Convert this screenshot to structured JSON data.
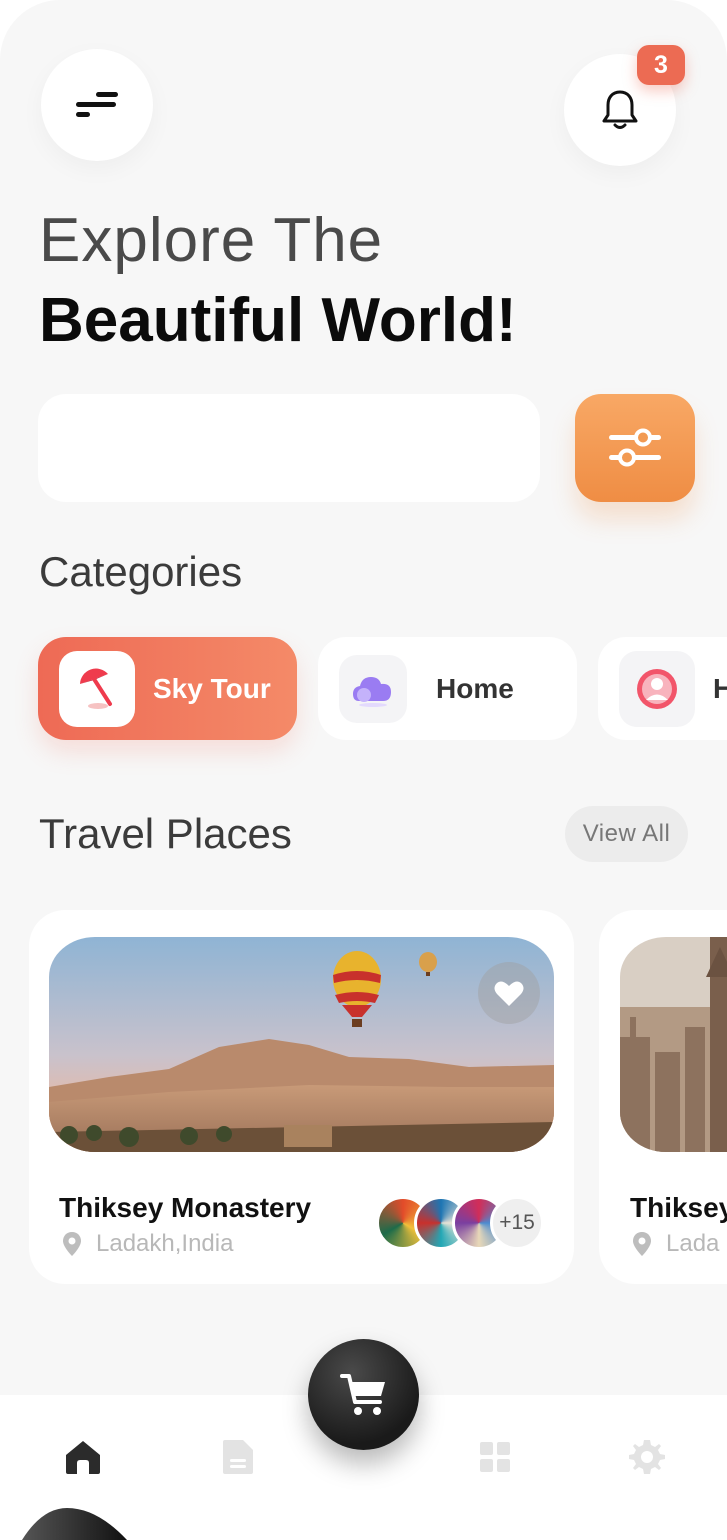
{
  "header": {
    "menu_icon": "menu-icon",
    "bell_icon": "bell-icon",
    "notification_count": "3"
  },
  "hero": {
    "line1": "Explore The",
    "line2": "Beautiful World!"
  },
  "search": {
    "value": "",
    "filter_icon": "sliders-icon"
  },
  "categories": {
    "title": "Categories",
    "items": [
      {
        "label": "Sky Tour",
        "icon": "umbrella-icon",
        "active": true
      },
      {
        "label": "Home",
        "icon": "cloud-home-icon",
        "active": false
      },
      {
        "label": "H",
        "icon": "person-icon",
        "active": false
      }
    ]
  },
  "travel": {
    "title": "Travel Places",
    "view_all": "View All",
    "places": [
      {
        "name": "Thiksey Monastery",
        "location": "Ladakh,India",
        "extra_count": "+15",
        "favorite_icon": "heart-icon"
      },
      {
        "name": "Thiksey",
        "location": "Lada"
      }
    ]
  },
  "bottom_nav": {
    "items": [
      "home-icon",
      "document-icon",
      "grid-icon",
      "gear-icon"
    ],
    "cart_icon": "cart-icon"
  },
  "colors": {
    "accent_orange": "#ef8d44",
    "accent_red": "#ee6a55",
    "badge": "#ec6b53",
    "background": "#f7f7f7"
  }
}
